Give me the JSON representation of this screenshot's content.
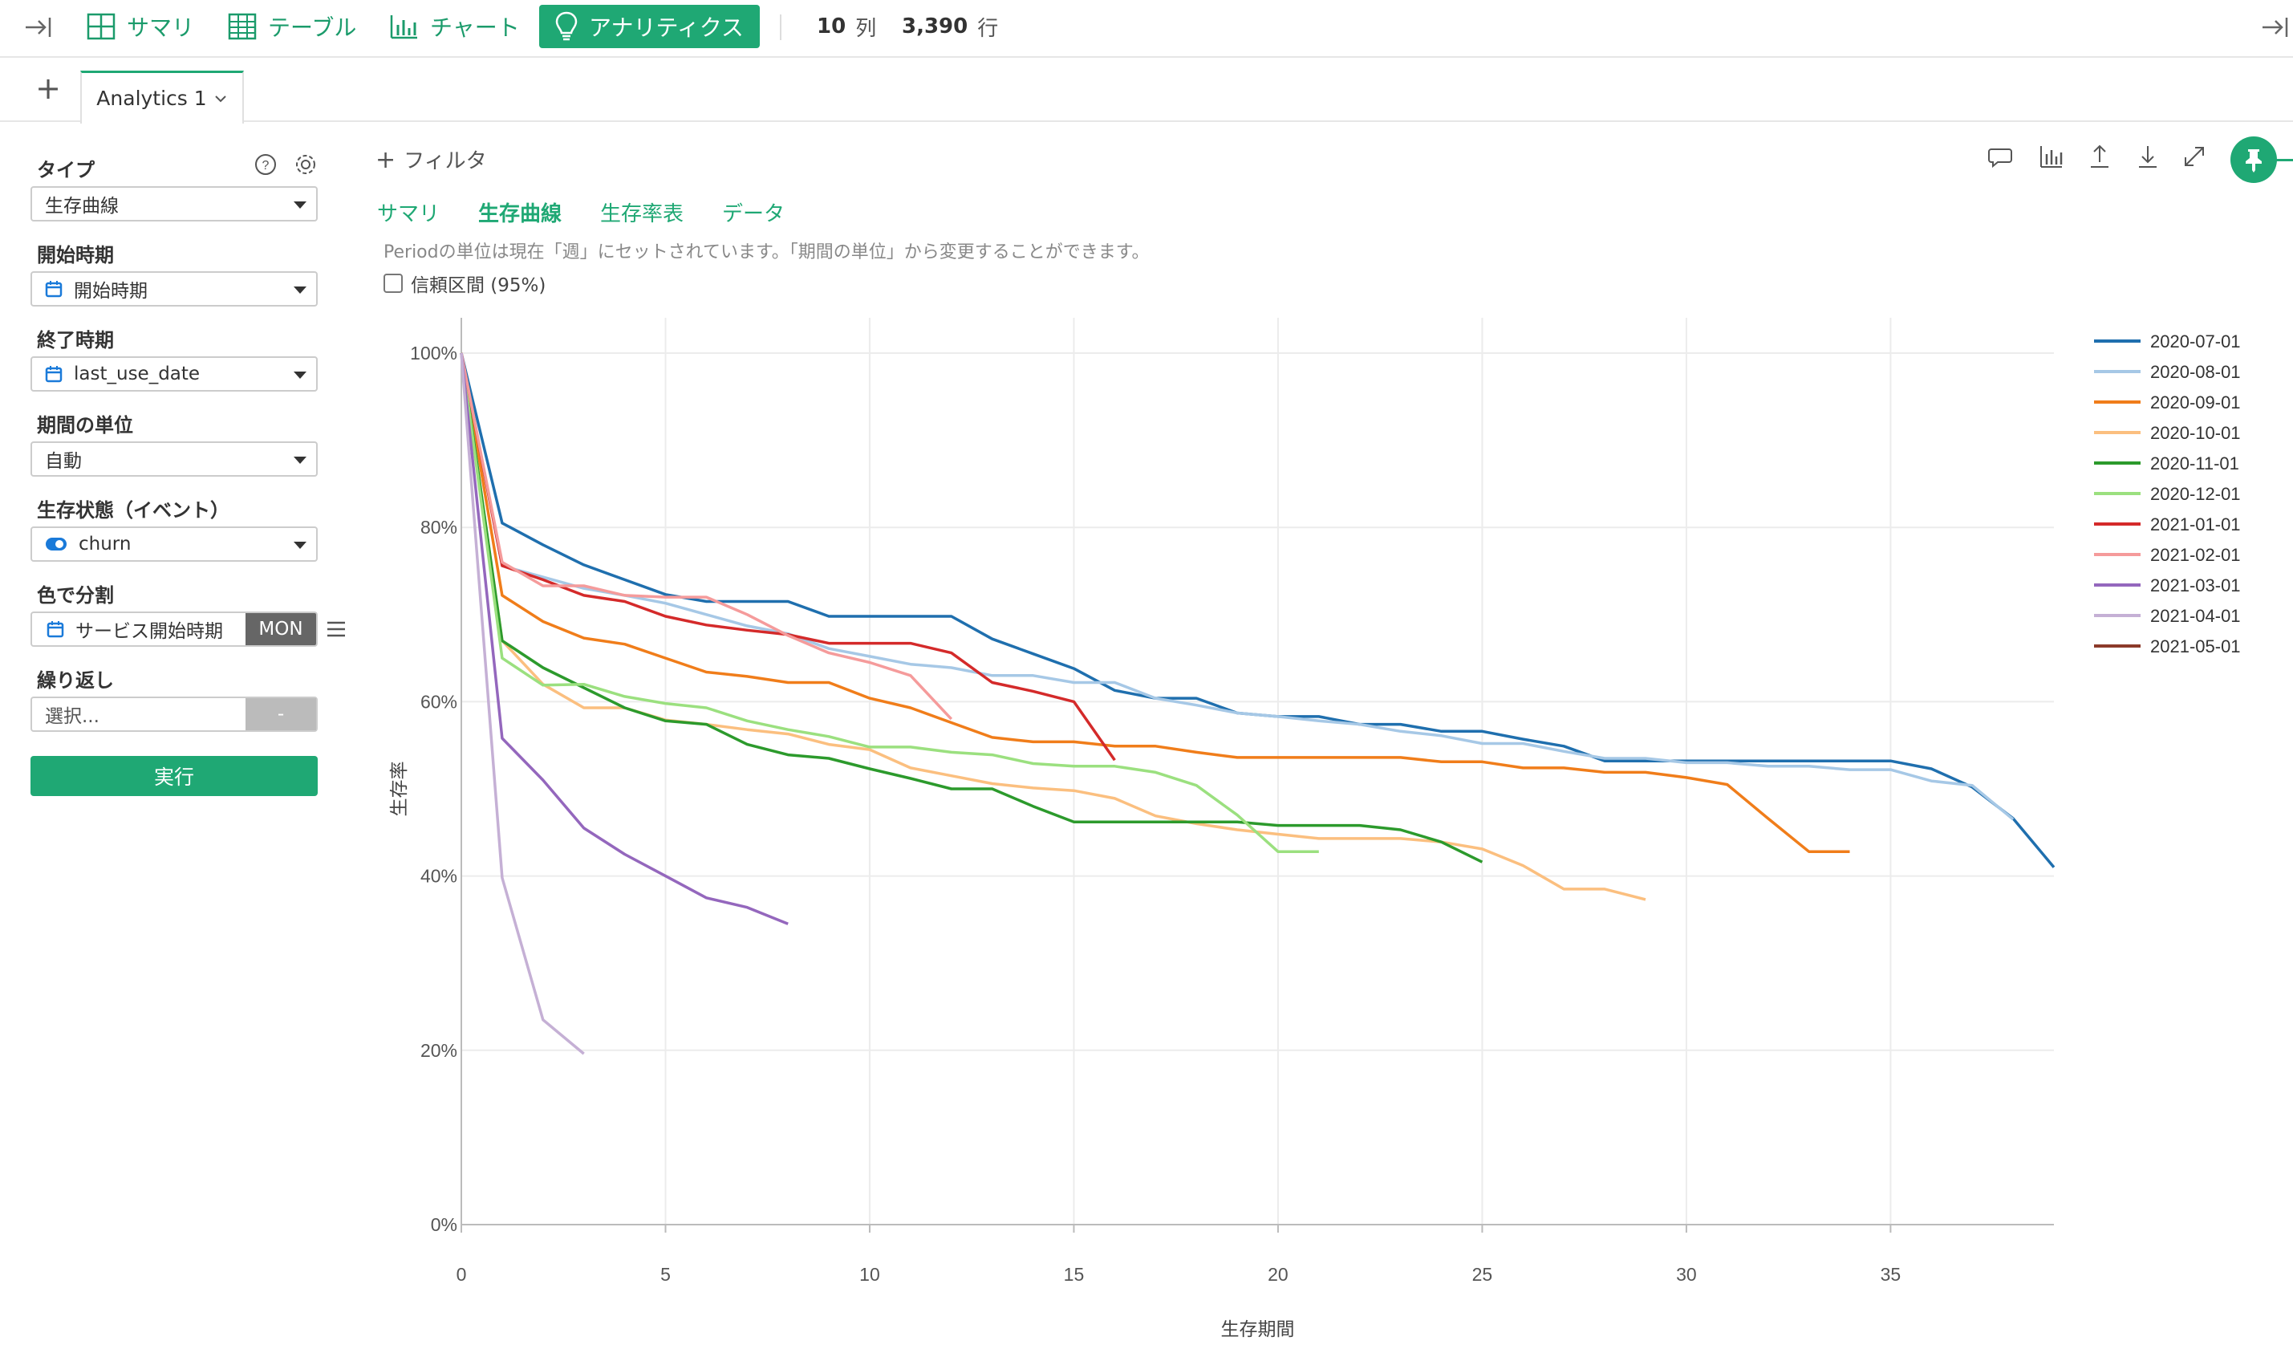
{
  "toolbar": {
    "items": [
      {
        "label": "サマリ",
        "icon": "grid-icon"
      },
      {
        "label": "テーブル",
        "icon": "table-icon"
      },
      {
        "label": "チャート",
        "icon": "bar-chart-icon"
      },
      {
        "label": "アナリティクス",
        "icon": "lightbulb-icon",
        "active": true
      }
    ],
    "columns_count": "10",
    "columns_unit": "列",
    "rows_count": "3,390",
    "rows_unit": "行"
  },
  "tabs": {
    "add_label": "+",
    "items": [
      {
        "label": "Analytics 1"
      }
    ]
  },
  "panel": {
    "type_label": "タイプ",
    "type_value": "生存曲線",
    "start_label": "開始時期",
    "start_value": "開始時期",
    "end_label": "終了時期",
    "end_value": "last_use_date",
    "unit_label": "期間の単位",
    "unit_value": "自動",
    "state_label": "生存状態（イベント）",
    "state_value": "churn",
    "color_label": "色で分割",
    "color_value": "サービス開始時期",
    "color_badge": "MON",
    "repeat_label": "繰り返し",
    "repeat_placeholder": "選択...",
    "repeat_btn": "-",
    "run_label": "実行"
  },
  "main": {
    "filter_label": "フィルタ",
    "subtabs": [
      "サマリ",
      "生存曲線",
      "生存率表",
      "データ"
    ],
    "active_subtab": "生存曲線",
    "info_text": "Periodの単位は現在「週」にセットされています。「期間の単位」から変更することができます。",
    "ci_label": "信頼区間 (95%)",
    "ci_checked": false
  },
  "colors": {
    "accent": "#1fa874"
  },
  "chart_data": {
    "type": "line",
    "xlabel": "生存期間",
    "ylabel": "生存率",
    "xlim": [
      0,
      39
    ],
    "ylim": [
      0,
      100
    ],
    "x_ticks": [
      0,
      5,
      10,
      15,
      20,
      25,
      30,
      35
    ],
    "y_ticks": [
      0,
      20,
      40,
      60,
      80,
      100
    ],
    "y_tick_labels": [
      "0%",
      "20%",
      "40%",
      "60%",
      "80%",
      "100%"
    ],
    "grid": true,
    "legend_position": "right",
    "series": [
      {
        "name": "2020-07-01",
        "color": "#1f6fae",
        "points": [
          [
            0,
            100
          ],
          [
            1,
            80.5
          ],
          [
            2,
            78
          ],
          [
            3,
            75.7
          ],
          [
            4,
            74
          ],
          [
            5,
            72.3
          ],
          [
            6,
            71.5
          ],
          [
            7,
            71.5
          ],
          [
            8,
            71.5
          ],
          [
            9,
            69.8
          ],
          [
            10,
            69.8
          ],
          [
            11,
            69.8
          ],
          [
            12,
            69.8
          ],
          [
            13,
            67.2
          ],
          [
            14,
            65.5
          ],
          [
            15,
            63.8
          ],
          [
            16,
            61.3
          ],
          [
            17,
            60.4
          ],
          [
            18,
            60.4
          ],
          [
            19,
            58.7
          ],
          [
            20,
            58.3
          ],
          [
            21,
            58.3
          ],
          [
            22,
            57.4
          ],
          [
            23,
            57.4
          ],
          [
            24,
            56.6
          ],
          [
            25,
            56.6
          ],
          [
            26,
            55.7
          ],
          [
            27,
            54.9
          ],
          [
            28,
            53.2
          ],
          [
            29,
            53.2
          ],
          [
            30,
            53.2
          ],
          [
            31,
            53.2
          ],
          [
            32,
            53.2
          ],
          [
            33,
            53.2
          ],
          [
            34,
            53.2
          ],
          [
            35,
            53.2
          ],
          [
            36,
            52.3
          ],
          [
            37,
            50.2
          ],
          [
            38,
            46.6
          ],
          [
            39,
            41
          ]
        ]
      },
      {
        "name": "2020-08-01",
        "color": "#a6c8e6",
        "points": [
          [
            0,
            100
          ],
          [
            1,
            75.6
          ],
          [
            2,
            74.3
          ],
          [
            3,
            73
          ],
          [
            4,
            72.2
          ],
          [
            5,
            71.3
          ],
          [
            6,
            70
          ],
          [
            7,
            68.7
          ],
          [
            8,
            67.8
          ],
          [
            9,
            66.1
          ],
          [
            10,
            65.2
          ],
          [
            11,
            64.3
          ],
          [
            12,
            63.9
          ],
          [
            13,
            63
          ],
          [
            14,
            63
          ],
          [
            15,
            62.2
          ],
          [
            16,
            62.2
          ],
          [
            17,
            60.4
          ],
          [
            18,
            59.6
          ],
          [
            19,
            58.7
          ],
          [
            20,
            58.3
          ],
          [
            21,
            57.8
          ],
          [
            22,
            57.4
          ],
          [
            23,
            56.6
          ],
          [
            24,
            56.1
          ],
          [
            25,
            55.2
          ],
          [
            26,
            55.2
          ],
          [
            27,
            54.3
          ],
          [
            28,
            53.5
          ],
          [
            29,
            53.5
          ],
          [
            30,
            53
          ],
          [
            31,
            53
          ],
          [
            32,
            52.6
          ],
          [
            33,
            52.6
          ],
          [
            34,
            52.2
          ],
          [
            35,
            52.2
          ],
          [
            36,
            50.9
          ],
          [
            37,
            50.4
          ],
          [
            38,
            46.5
          ]
        ]
      },
      {
        "name": "2020-09-01",
        "color": "#f07d1a",
        "points": [
          [
            0,
            100
          ],
          [
            1,
            72.2
          ],
          [
            2,
            69.2
          ],
          [
            3,
            67.3
          ],
          [
            4,
            66.6
          ],
          [
            5,
            65
          ],
          [
            6,
            63.4
          ],
          [
            7,
            62.9
          ],
          [
            8,
            62.2
          ],
          [
            9,
            62.2
          ],
          [
            10,
            60.4
          ],
          [
            11,
            59.3
          ],
          [
            12,
            57.6
          ],
          [
            13,
            55.9
          ],
          [
            14,
            55.4
          ],
          [
            15,
            55.4
          ],
          [
            16,
            54.9
          ],
          [
            17,
            54.9
          ],
          [
            18,
            54.2
          ],
          [
            19,
            53.6
          ],
          [
            20,
            53.6
          ],
          [
            21,
            53.6
          ],
          [
            22,
            53.6
          ],
          [
            23,
            53.6
          ],
          [
            24,
            53.1
          ],
          [
            25,
            53.1
          ],
          [
            26,
            52.4
          ],
          [
            27,
            52.4
          ],
          [
            28,
            51.9
          ],
          [
            29,
            51.9
          ],
          [
            30,
            51.3
          ],
          [
            31,
            50.5
          ],
          [
            32,
            46.6
          ],
          [
            33,
            42.8
          ],
          [
            34,
            42.8
          ]
        ]
      },
      {
        "name": "2020-10-01",
        "color": "#fbbf7f",
        "points": [
          [
            0,
            100
          ],
          [
            1,
            67
          ],
          [
            2,
            62
          ],
          [
            3,
            59.3
          ],
          [
            4,
            59.3
          ],
          [
            5,
            57.9
          ],
          [
            6,
            57.4
          ],
          [
            7,
            56.8
          ],
          [
            8,
            56.3
          ],
          [
            9,
            55.1
          ],
          [
            10,
            54.5
          ],
          [
            11,
            52.4
          ],
          [
            12,
            51.5
          ],
          [
            13,
            50.6
          ],
          [
            14,
            50.1
          ],
          [
            15,
            49.8
          ],
          [
            16,
            48.9
          ],
          [
            17,
            46.9
          ],
          [
            18,
            46
          ],
          [
            19,
            45.3
          ],
          [
            20,
            44.8
          ],
          [
            21,
            44.3
          ],
          [
            22,
            44.3
          ],
          [
            23,
            44.3
          ],
          [
            24,
            43.9
          ],
          [
            25,
            43.1
          ],
          [
            26,
            41.2
          ],
          [
            27,
            38.5
          ],
          [
            28,
            38.5
          ],
          [
            29,
            37.3
          ]
        ]
      },
      {
        "name": "2020-11-01",
        "color": "#2c9a2c",
        "points": [
          [
            0,
            100
          ],
          [
            1,
            67
          ],
          [
            2,
            63.9
          ],
          [
            3,
            61.6
          ],
          [
            4,
            59.3
          ],
          [
            5,
            57.8
          ],
          [
            6,
            57.4
          ],
          [
            7,
            55.1
          ],
          [
            8,
            53.9
          ],
          [
            9,
            53.5
          ],
          [
            10,
            52.3
          ],
          [
            11,
            51.2
          ],
          [
            12,
            50
          ],
          [
            13,
            50
          ],
          [
            14,
            48
          ],
          [
            15,
            46.2
          ],
          [
            16,
            46.2
          ],
          [
            17,
            46.2
          ],
          [
            18,
            46.2
          ],
          [
            19,
            46.2
          ],
          [
            20,
            45.8
          ],
          [
            21,
            45.8
          ],
          [
            22,
            45.8
          ],
          [
            23,
            45.3
          ],
          [
            24,
            43.9
          ],
          [
            25,
            41.6
          ]
        ]
      },
      {
        "name": "2020-12-01",
        "color": "#9be07f",
        "points": [
          [
            0,
            100
          ],
          [
            1,
            65
          ],
          [
            2,
            61.9
          ],
          [
            3,
            62
          ],
          [
            4,
            60.6
          ],
          [
            5,
            59.8
          ],
          [
            6,
            59.3
          ],
          [
            7,
            57.8
          ],
          [
            8,
            56.8
          ],
          [
            9,
            56
          ],
          [
            10,
            54.8
          ],
          [
            11,
            54.8
          ],
          [
            12,
            54.2
          ],
          [
            13,
            53.9
          ],
          [
            14,
            52.9
          ],
          [
            15,
            52.6
          ],
          [
            16,
            52.6
          ],
          [
            17,
            51.9
          ],
          [
            18,
            50.4
          ],
          [
            19,
            47
          ],
          [
            20,
            42.8
          ],
          [
            21,
            42.8
          ]
        ]
      },
      {
        "name": "2021-01-01",
        "color": "#d42a2a",
        "points": [
          [
            0,
            100
          ],
          [
            1,
            75.6
          ],
          [
            2,
            74
          ],
          [
            3,
            72.2
          ],
          [
            4,
            71.5
          ],
          [
            5,
            69.8
          ],
          [
            6,
            68.8
          ],
          [
            7,
            68.2
          ],
          [
            8,
            67.7
          ],
          [
            9,
            66.7
          ],
          [
            10,
            66.7
          ],
          [
            11,
            66.7
          ],
          [
            12,
            65.6
          ],
          [
            13,
            62.2
          ],
          [
            14,
            61.2
          ],
          [
            15,
            60
          ],
          [
            16,
            53.3
          ]
        ]
      },
      {
        "name": "2021-02-01",
        "color": "#f59b9b",
        "points": [
          [
            0,
            100
          ],
          [
            1,
            76
          ],
          [
            2,
            73.3
          ],
          [
            3,
            73.3
          ],
          [
            4,
            72.2
          ],
          [
            5,
            72
          ],
          [
            6,
            72
          ],
          [
            7,
            70
          ],
          [
            8,
            67.6
          ],
          [
            9,
            65.6
          ],
          [
            10,
            64.5
          ],
          [
            11,
            63
          ],
          [
            12,
            58
          ]
        ]
      },
      {
        "name": "2021-03-01",
        "color": "#9467bd",
        "points": [
          [
            0,
            100
          ],
          [
            1,
            55.8
          ],
          [
            2,
            51
          ],
          [
            3,
            45.5
          ],
          [
            4,
            42.5
          ],
          [
            5,
            40
          ],
          [
            6,
            37.5
          ],
          [
            7,
            36.4
          ],
          [
            8,
            34.5
          ]
        ]
      },
      {
        "name": "2021-04-01",
        "color": "#c5b0d5",
        "points": [
          [
            0,
            100
          ],
          [
            1,
            39.8
          ],
          [
            2,
            23.5
          ],
          [
            3,
            19.6
          ]
        ]
      },
      {
        "name": "2021-05-01",
        "color": "#8c3a2a",
        "points": [
          [
            0,
            100
          ]
        ]
      }
    ]
  }
}
